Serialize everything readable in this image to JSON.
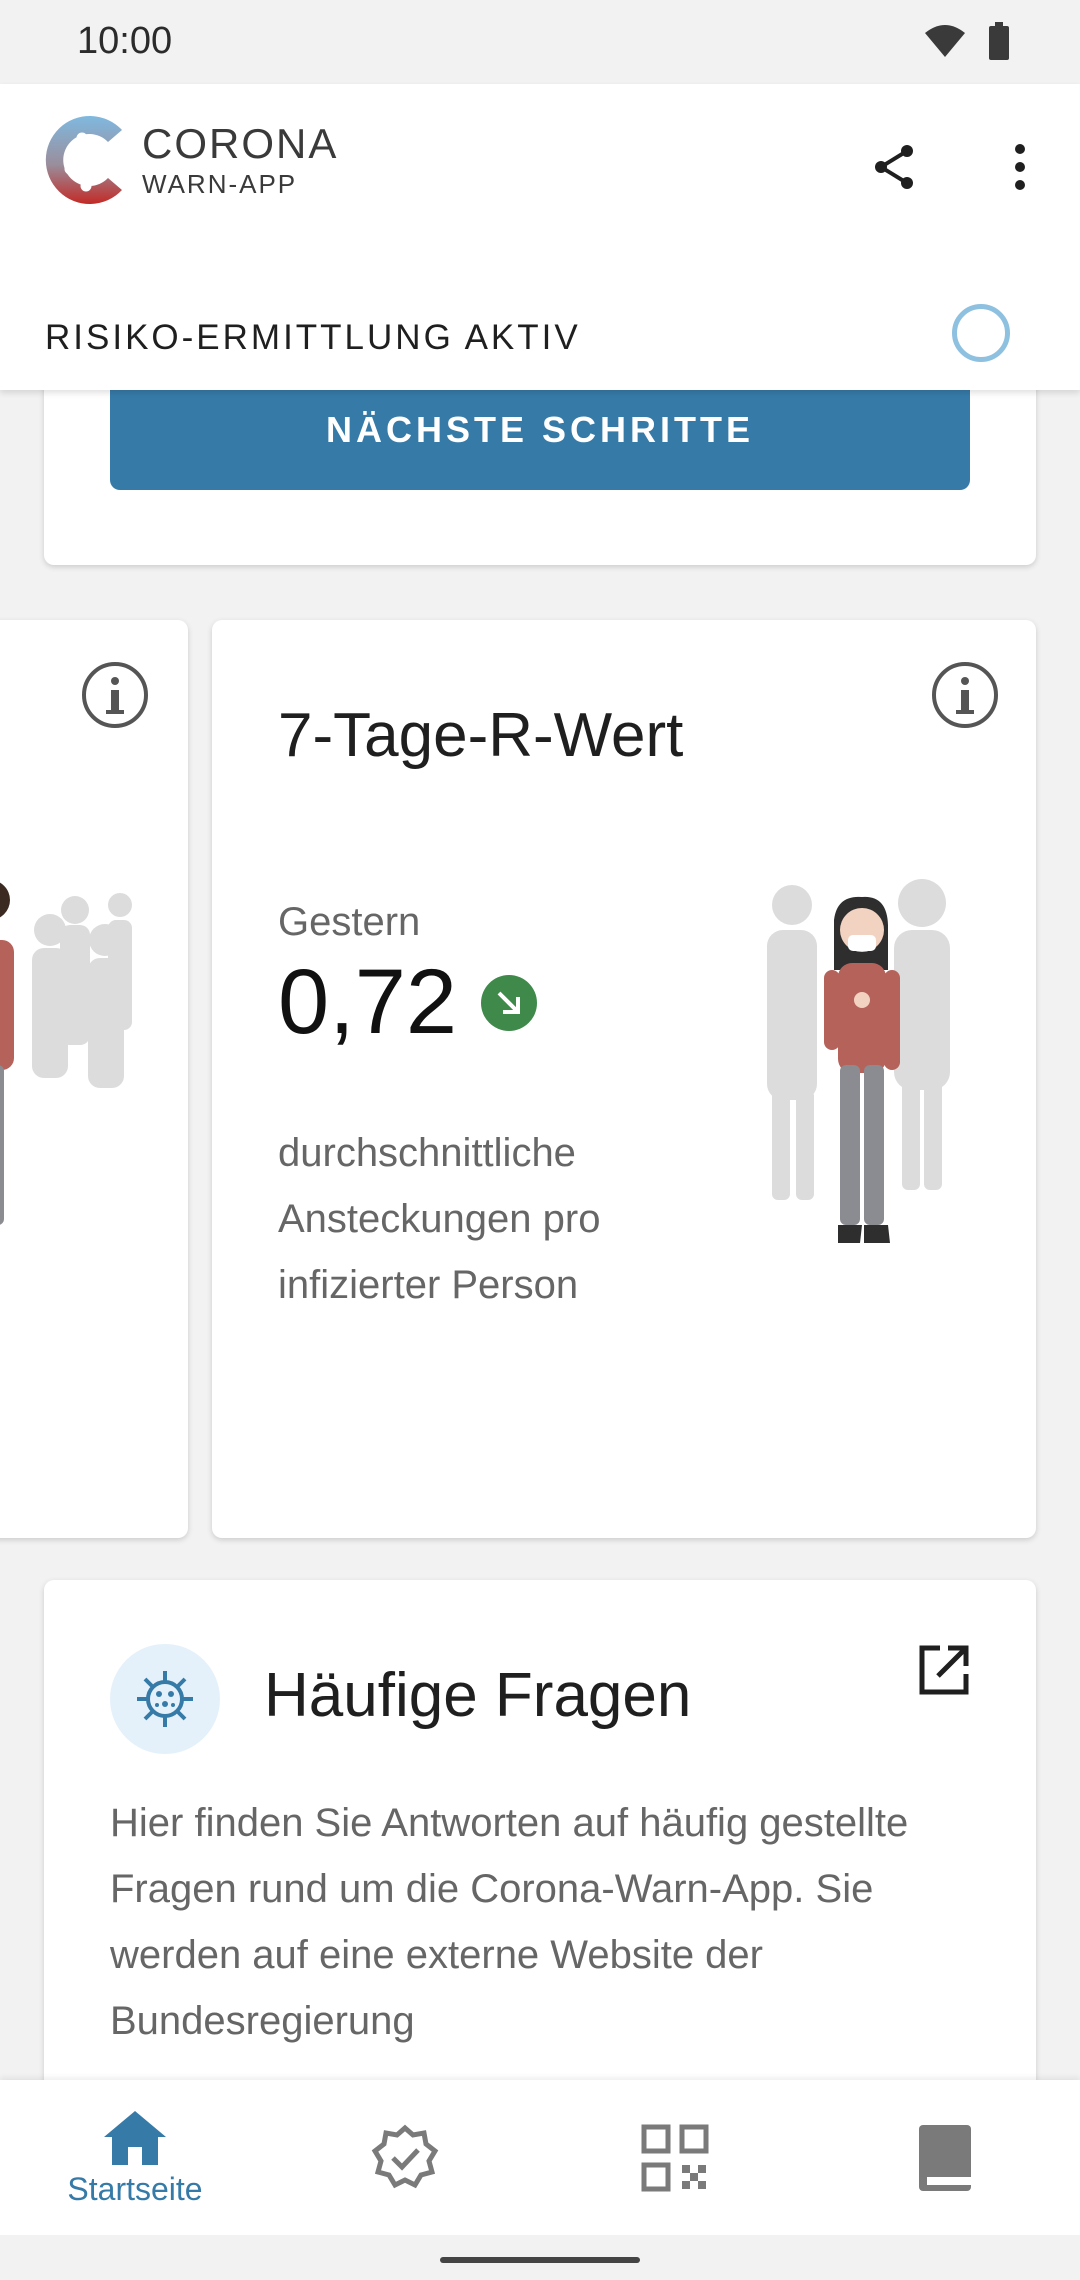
{
  "status_bar": {
    "time": "10:00"
  },
  "header": {
    "logo_title": "CORONA",
    "logo_subtitle": "WARN-APP",
    "risk_status": "RISIKO-ERMITTLUNG AKTIV"
  },
  "top_card": {
    "button_label": "NÄCHSTE SCHRITTE"
  },
  "r_value_card": {
    "title": "7-Tage-R-Wert",
    "caption": "Gestern",
    "value": "0,72",
    "trend": "down",
    "description": "durchschnittliche Ansteckungen pro infizierter Person"
  },
  "faq_card": {
    "title": "Häufige Fragen",
    "text": "Hier finden Sie Antworten auf häufig gestellte Fragen rund um die Corona-Warn-App. Sie werden auf eine externe Website der Bundesregierung"
  },
  "bottom_nav": {
    "items": [
      {
        "label": "Startseite",
        "icon": "home-icon",
        "active": true
      },
      {
        "label": "",
        "icon": "certificate-check-icon",
        "active": false
      },
      {
        "label": "",
        "icon": "qr-code-icon",
        "active": false
      },
      {
        "label": "",
        "icon": "diary-book-icon",
        "active": false
      }
    ]
  },
  "colors": {
    "accent": "#367ba8",
    "trend_green": "#3f8a4b",
    "text_secondary": "#666666"
  }
}
